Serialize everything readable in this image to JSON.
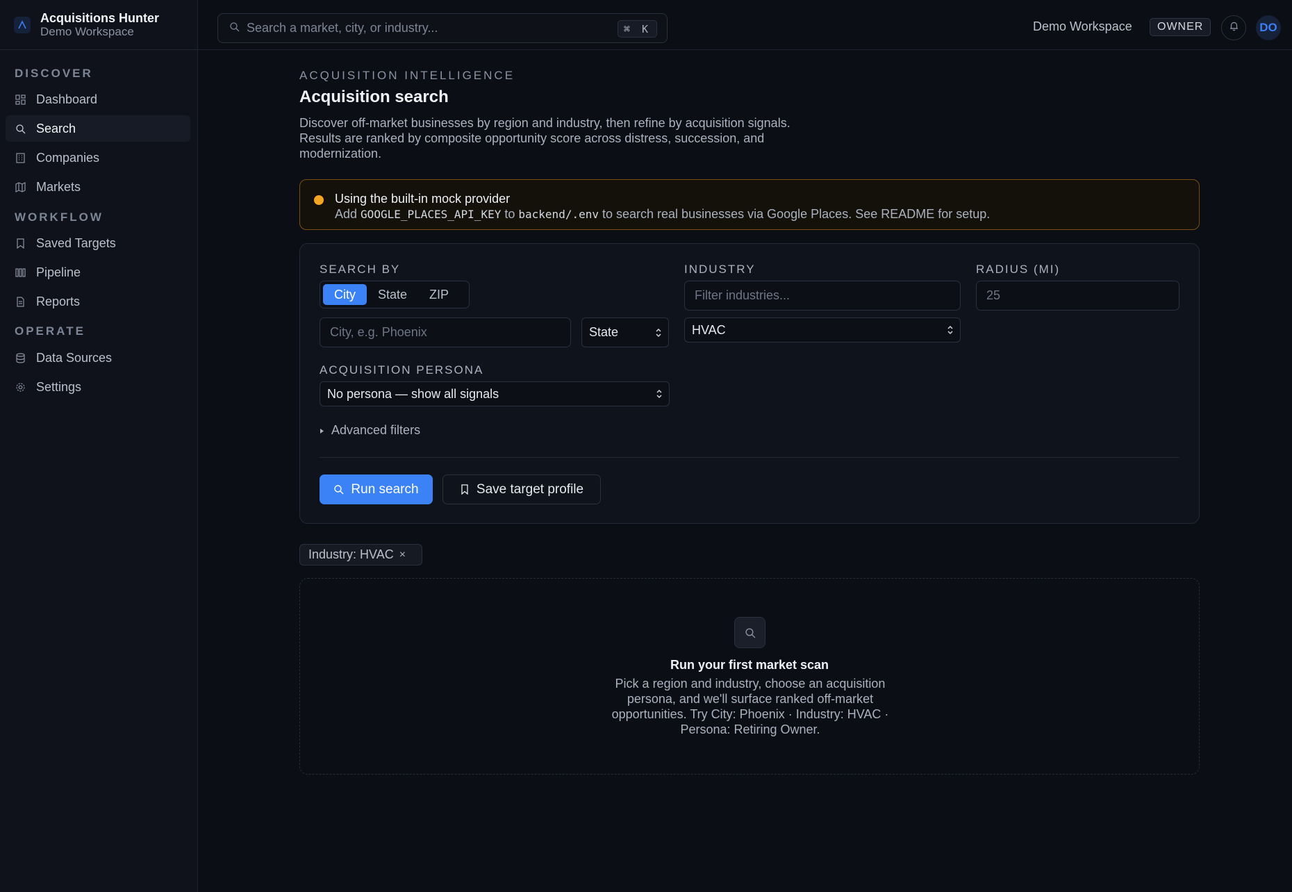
{
  "brand": {
    "title": "Acquisitions Hunter",
    "subtitle": "Demo Workspace"
  },
  "topbar": {
    "search_placeholder": "Search a market, city, or industry...",
    "shortcut": "⌘ K",
    "workspace": "Demo Workspace",
    "role": "OWNER",
    "avatar_initials": "DO"
  },
  "sidebar": {
    "sections": [
      {
        "label": "DISCOVER",
        "items": [
          {
            "label": "Dashboard",
            "icon": "grid-icon"
          },
          {
            "label": "Search",
            "icon": "search-icon",
            "active": true
          },
          {
            "label": "Companies",
            "icon": "building-icon"
          },
          {
            "label": "Markets",
            "icon": "map-icon"
          }
        ]
      },
      {
        "label": "WORKFLOW",
        "items": [
          {
            "label": "Saved Targets",
            "icon": "bookmark-icon"
          },
          {
            "label": "Pipeline",
            "icon": "columns-icon"
          },
          {
            "label": "Reports",
            "icon": "file-icon"
          }
        ]
      },
      {
        "label": "OPERATE",
        "items": [
          {
            "label": "Data Sources",
            "icon": "database-icon"
          },
          {
            "label": "Settings",
            "icon": "gear-icon"
          }
        ]
      }
    ]
  },
  "main": {
    "eyebrow": "ACQUISITION INTELLIGENCE",
    "title": "Acquisition search",
    "description": "Discover off-market businesses by region and industry, then refine by acquisition signals. Results are ranked by composite opportunity score across distress, succession, and modernization.",
    "alert": {
      "title": "Using the built-in mock provider",
      "body_prefix": "Add",
      "env_key": "GOOGLE_PLACES_API_KEY",
      "body_mid": "to",
      "env_path": "backend/.env",
      "body_suffix": "to search real businesses via Google Places. See README for setup."
    },
    "form": {
      "search_by_label": "SEARCH BY",
      "search_by_options": [
        "City",
        "State",
        "ZIP"
      ],
      "search_by_selected": "City",
      "city_placeholder": "City, e.g. Phoenix",
      "state_select": "State",
      "industry_label": "INDUSTRY",
      "industry_filter_placeholder": "Filter industries...",
      "industry_select": "HVAC",
      "radius_label": "RADIUS (MI)",
      "radius_placeholder": "25",
      "persona_label": "ACQUISITION PERSONA",
      "persona_select": "No persona — show all signals",
      "advanced_filters": "Advanced filters",
      "run_button": "Run search",
      "save_button": "Save target profile"
    },
    "active_filter_chip": "Industry: HVAC",
    "empty_state": {
      "title": "Run your first market scan",
      "description": "Pick a region and industry, choose an acquisition persona, and we'll surface ranked off-market opportunities. Try City: Phoenix · Industry: HVAC · Persona: Retiring Owner."
    }
  },
  "colors": {
    "accent": "#3b82f6",
    "warning": "#f5a524",
    "background": "#0b0e14"
  }
}
